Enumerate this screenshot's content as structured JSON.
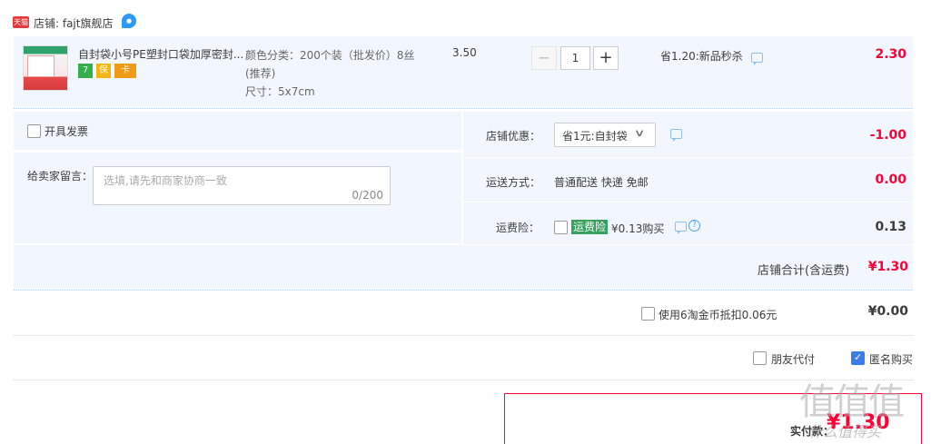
{
  "shop": {
    "badge": "天猫",
    "name": "店铺: fajt旗舰店",
    "ww_icon": "ww-chat-icon"
  },
  "item": {
    "title": "自封袋小号PE塑封口袋加厚密封...",
    "services": [
      "7",
      "保",
      "卡"
    ],
    "sku_color": "颜色分类：200个装（批发价）8丝(推荐)",
    "sku_size": "尺寸：5x7cm",
    "unit_price": "3.50",
    "qty_minus": "−",
    "quantity": "1",
    "qty_plus": "+",
    "promo": "省1.20:新品秒杀",
    "subtotal": "2.30"
  },
  "options": {
    "invoice_label": "开具发票",
    "message_label": "给卖家留言：",
    "message_placeholder": "选填,请先和商家协商一致",
    "message_count": "0/200",
    "shop_discount_label": "店铺优惠：",
    "shop_discount_value": "省1元:自封袋",
    "shop_discount_amount": "-1.00",
    "shipping_label": "运送方式：",
    "shipping_value": "普通配送 快递 免邮",
    "shipping_amount": "0.00",
    "insurance_label": "运费险：",
    "insurance_badge": "运费险",
    "insurance_price": "¥0.13购买",
    "insurance_amount": "0.13",
    "help": "?"
  },
  "summary": {
    "shop_total_label": "店铺合计(含运费)",
    "shop_total_value": "¥1.30",
    "coin_label": "使用6淘金币抵扣0.06元",
    "coin_value": "¥0.00",
    "friend_pay_label": "朋友代付",
    "anonymous_label": "匿名购买",
    "anonymous_checked": true,
    "pay_label": "实付款：",
    "pay_amount": "¥1.30"
  },
  "watermark": {
    "main": "值值值",
    "sub": "什么值得买"
  },
  "colors": {
    "accent_red": "#ff0036",
    "panel_blue": "#f2f7ff",
    "checkbox_blue": "#3a7de9",
    "insurance_green": "#36a15e"
  }
}
